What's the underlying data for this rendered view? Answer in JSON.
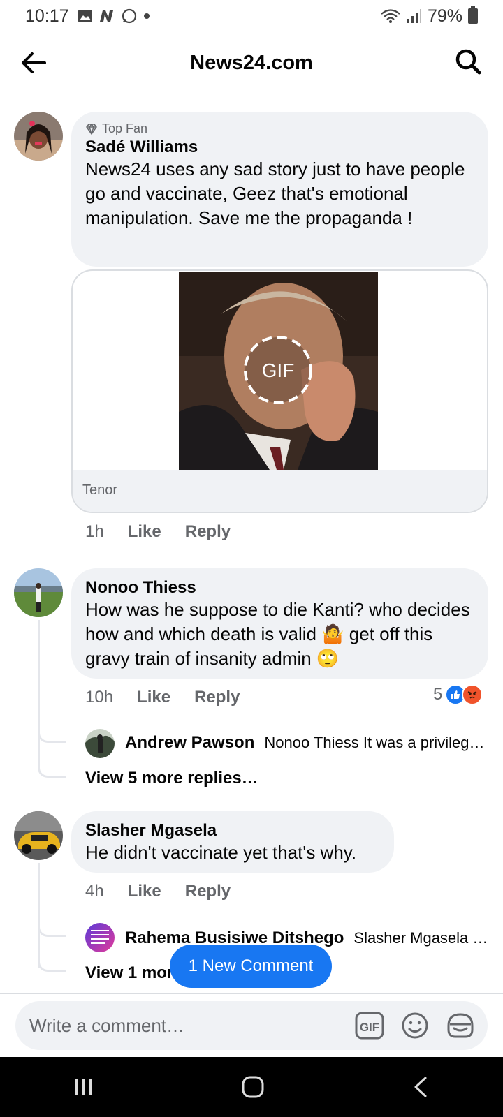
{
  "status_bar": {
    "time": "10:17",
    "battery": "79%"
  },
  "header": {
    "title": "News24.com"
  },
  "comments": [
    {
      "badge": "Top Fan",
      "author": "Sadé Williams",
      "text": "News24 uses any sad story just to have people go and vaccinate,  Geez  that's emotional manipulation.  Save me the propaganda !",
      "gif_label": "GIF",
      "gif_source": "Tenor",
      "time": "1h",
      "like": "Like",
      "reply": "Reply"
    },
    {
      "author": "Nonoo Thiess",
      "text": " How was he suppose to die Kanti? who decides how and which death is valid 🤷 get off this gravy train of insanity admin 🙄",
      "time": "10h",
      "like": "Like",
      "reply": "Reply",
      "reaction_count": "5",
      "reply_preview": {
        "author": "Andrew Pawson",
        "text": "Nonoo Thiess It was a privileg…"
      },
      "more_replies": "View 5 more replies…"
    },
    {
      "author": "Slasher Mgasela",
      "text": "He didn't vaccinate yet that's why.",
      "time": "4h",
      "like": "Like",
      "reply": "Reply",
      "reply_preview": {
        "author": "Rahema Busisiwe Ditshego",
        "text": "Slasher Mgasela v…"
      },
      "more_replies": "View 1 mor"
    }
  ],
  "new_comment_pill": "1 New Comment",
  "composer": {
    "placeholder": "Write a comment…"
  },
  "colors": {
    "accent": "#1877f2",
    "bubble": "#f0f2f5",
    "muted": "#65676b",
    "angry": "#f0532b"
  }
}
